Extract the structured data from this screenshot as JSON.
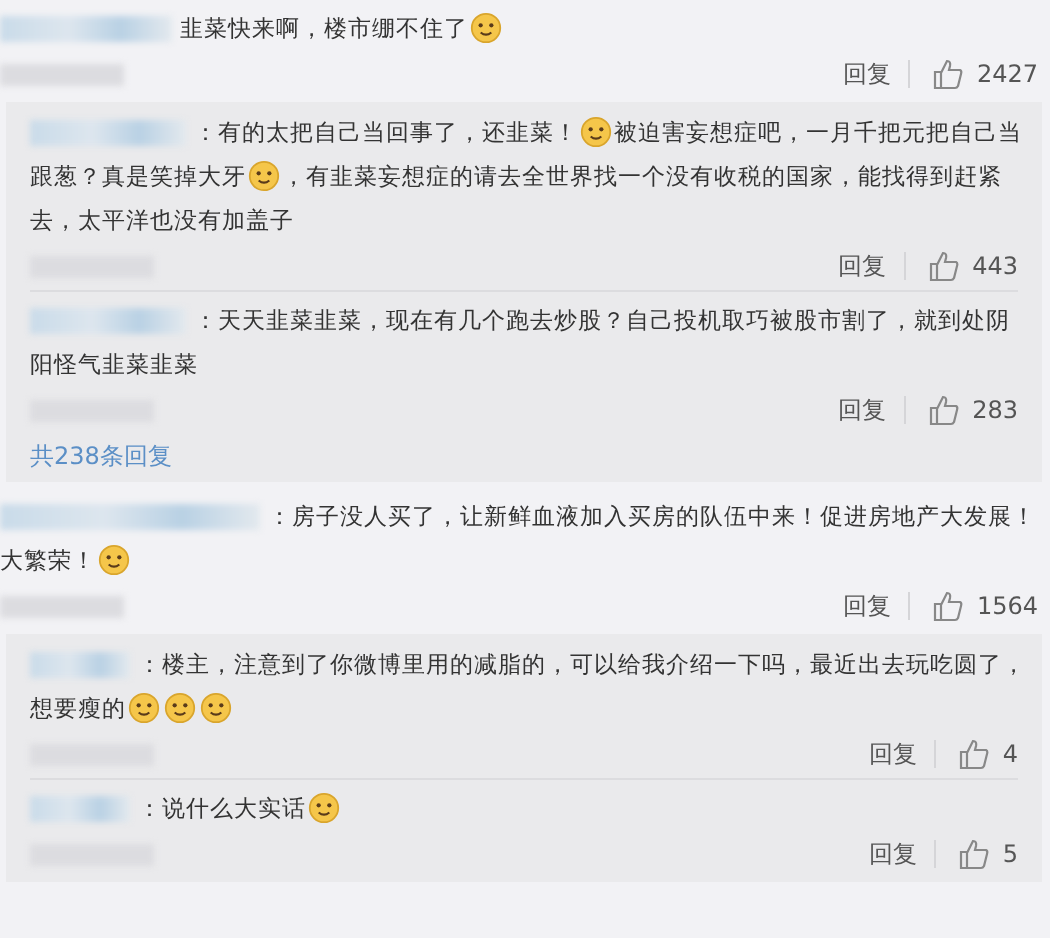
{
  "threads": [
    {
      "comment": {
        "lines": [
          [
            {
              "kind": "text",
              "text": "韭菜快来啊，楼市绷不住了"
            },
            {
              "kind": "emoji"
            }
          ]
        ],
        "reply_label": "回复",
        "likes": "2427"
      },
      "replies": [
        {
          "lines": [
            [
              {
                "kind": "text",
                "text": "：有的太把自己当回事了，还韭菜！"
              },
              {
                "kind": "emoji"
              },
              {
                "kind": "text",
                "text": "被迫害妄想症吧，一月千把元把自己当"
              }
            ],
            [
              {
                "kind": "text",
                "text": "跟葱？真是笑掉大牙"
              },
              {
                "kind": "emoji"
              },
              {
                "kind": "text",
                "text": "，有韭菜妄想症的请去全世界找一个没有收税的国家，能找得到赶紧"
              }
            ],
            [
              {
                "kind": "text",
                "text": "去，太平洋也没有加盖子"
              }
            ]
          ],
          "reply_label": "回复",
          "likes": "443"
        },
        {
          "lines": [
            [
              {
                "kind": "text",
                "text": "：天天韭菜韭菜，现在有几个跑去炒股？自己投机取巧被股市割了，就到处阴"
              }
            ],
            [
              {
                "kind": "text",
                "text": "阳怪气韭菜韭菜"
              }
            ]
          ],
          "reply_label": "回复",
          "likes": "283"
        }
      ],
      "more_replies": "共238条回复"
    },
    {
      "comment": {
        "lines": [
          [
            {
              "kind": "text",
              "text": "：房子没人买了，让新鲜血液加入买房的队伍中来！促进房地产大发展！"
            }
          ],
          [
            {
              "kind": "text",
              "text": "大繁荣！"
            },
            {
              "kind": "emoji"
            }
          ]
        ],
        "reply_label": "回复",
        "likes": "1564"
      },
      "replies": [
        {
          "lines": [
            [
              {
                "kind": "text",
                "text": "：楼主，注意到了你微博里用的减脂的，可以给我介绍一下吗，最近出去玩吃圆了，"
              }
            ],
            [
              {
                "kind": "text",
                "text": "想要瘦的"
              },
              {
                "kind": "emoji"
              },
              {
                "kind": "emoji"
              },
              {
                "kind": "emoji"
              }
            ]
          ],
          "reply_label": "回复",
          "likes": "4"
        },
        {
          "lines": [
            [
              {
                "kind": "text",
                "text": "：说什么大实话"
              },
              {
                "kind": "emoji"
              }
            ]
          ],
          "reply_label": "回复",
          "likes": "5"
        }
      ]
    }
  ]
}
